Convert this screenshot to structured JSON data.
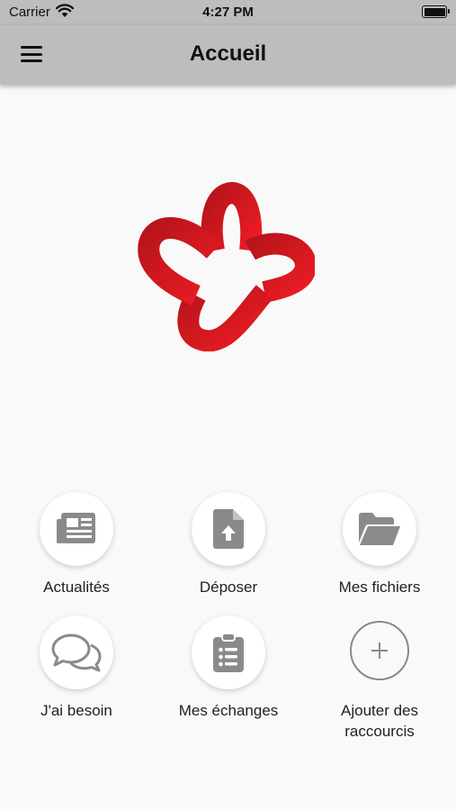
{
  "status_bar": {
    "carrier": "Carrier",
    "time": "4:27 PM"
  },
  "header": {
    "title": "Accueil",
    "menu_icon": "hamburger-menu-icon"
  },
  "brand": {
    "logo_color": "#d9161b"
  },
  "shortcuts": [
    {
      "label": "Actualités",
      "icon": "newspaper-icon"
    },
    {
      "label": "Déposer",
      "icon": "file-upload-icon"
    },
    {
      "label": "Mes fichiers",
      "icon": "folder-open-icon"
    },
    {
      "label": "J'ai besoin",
      "icon": "chat-bubbles-icon"
    },
    {
      "label": "Mes échanges",
      "icon": "clipboard-list-icon"
    },
    {
      "label": "Ajouter des raccourcis",
      "icon": "plus-icon"
    }
  ],
  "colors": {
    "bar_background": "#bdbdbd",
    "icon_gray": "#8a8a8a",
    "page_background": "#f9f9f9"
  }
}
